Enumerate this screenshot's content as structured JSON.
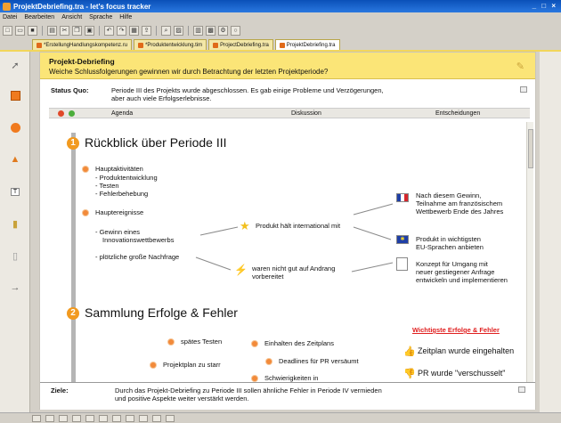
{
  "window": {
    "title": "ProjektDebriefing.tra - let's focus tracker",
    "controls": "_ □ ×"
  },
  "menu": [
    "Datei",
    "Bearbeiten",
    "Ansicht",
    "Sprache",
    "Hilfe"
  ],
  "tabs": [
    {
      "label": "*ErstellungHandlungskompetenz.ru",
      "active": false
    },
    {
      "label": "*Produktentwicklung.tim",
      "active": false
    },
    {
      "label": "ProjectDebriefing.tra",
      "active": false
    },
    {
      "label": "ProjektDebriefing.tra",
      "active": true
    }
  ],
  "header": {
    "title": "Projekt-Debriefing",
    "subtitle": "Weiche Schlussfolgerungen gewinnen wir durch Betrachtung der letzten Projektperiode?"
  },
  "status_quo": {
    "label": "Status Quo:",
    "line1": "Periode III des Projekts wurde abgeschlossen. Es gab einige Probleme und Verzögerungen,",
    "line2": "aber auch viele Erfolgserlebnisse."
  },
  "columns": [
    "Agenda",
    "Diskussion",
    "Entscheidungen"
  ],
  "section1": {
    "number": "1",
    "title": "Rückblick über Periode III",
    "hauptaktivitaeten": "Hauptaktivitäten",
    "aktivitaeten": [
      "- Produktentwicklung",
      "- Testen",
      "- Fehlerbehebung"
    ],
    "hauptereignisse": "Hauptereignisse",
    "gewinn1": "- Gewinn eines",
    "gewinn2": "Innovationswettbewerbs",
    "nachfrage": "- plötzliche große Nachfrage",
    "produkt_haelt": "Produkt hält international mit",
    "nicht_gut1": "waren nicht gut auf Andrang",
    "nicht_gut2": "vorbereitet",
    "dec1": [
      "Nach diesem Gewinn,",
      "Teilnahme am französischem",
      "Wettbewerb Ende des Jahres"
    ],
    "dec2": [
      "Produkt in wichtigsten",
      "EU-Sprachen anbieten"
    ],
    "dec3": [
      "Konzept für Umgang mit",
      "neuer gestiegener Anfrage",
      "entwickeln und implementieren"
    ]
  },
  "section2": {
    "number": "2",
    "title": "Sammlung Erfolge & Fehler",
    "wichtigste": "Wichtigste Erfolge & Fehler",
    "spaetes_testen": "spätes Testen",
    "projektplan": "Projektplan zu starr",
    "einhalten": "Einhalten des Zeitplans",
    "deadlines": "Deadlines für PR versäumt",
    "schwierigkeiten": "Schwierigkeiten in",
    "zeitplan": "Zeitplan wurde eingehalten",
    "pr_verschusselt": "PR wurde \"verschusselt\""
  },
  "footer": {
    "label": "Ziele:",
    "line1": "Durch das Projekt-Debriefing zu Periode III sollen ähnliche Fehler in Periode IV vermieden",
    "line2": "und positive Aspekte weiter verstärkt werden."
  },
  "colors": {
    "accent": "#fbe577",
    "bullet": "#f28a3a",
    "number": "#f29a1f",
    "red_link": "#e02020"
  }
}
